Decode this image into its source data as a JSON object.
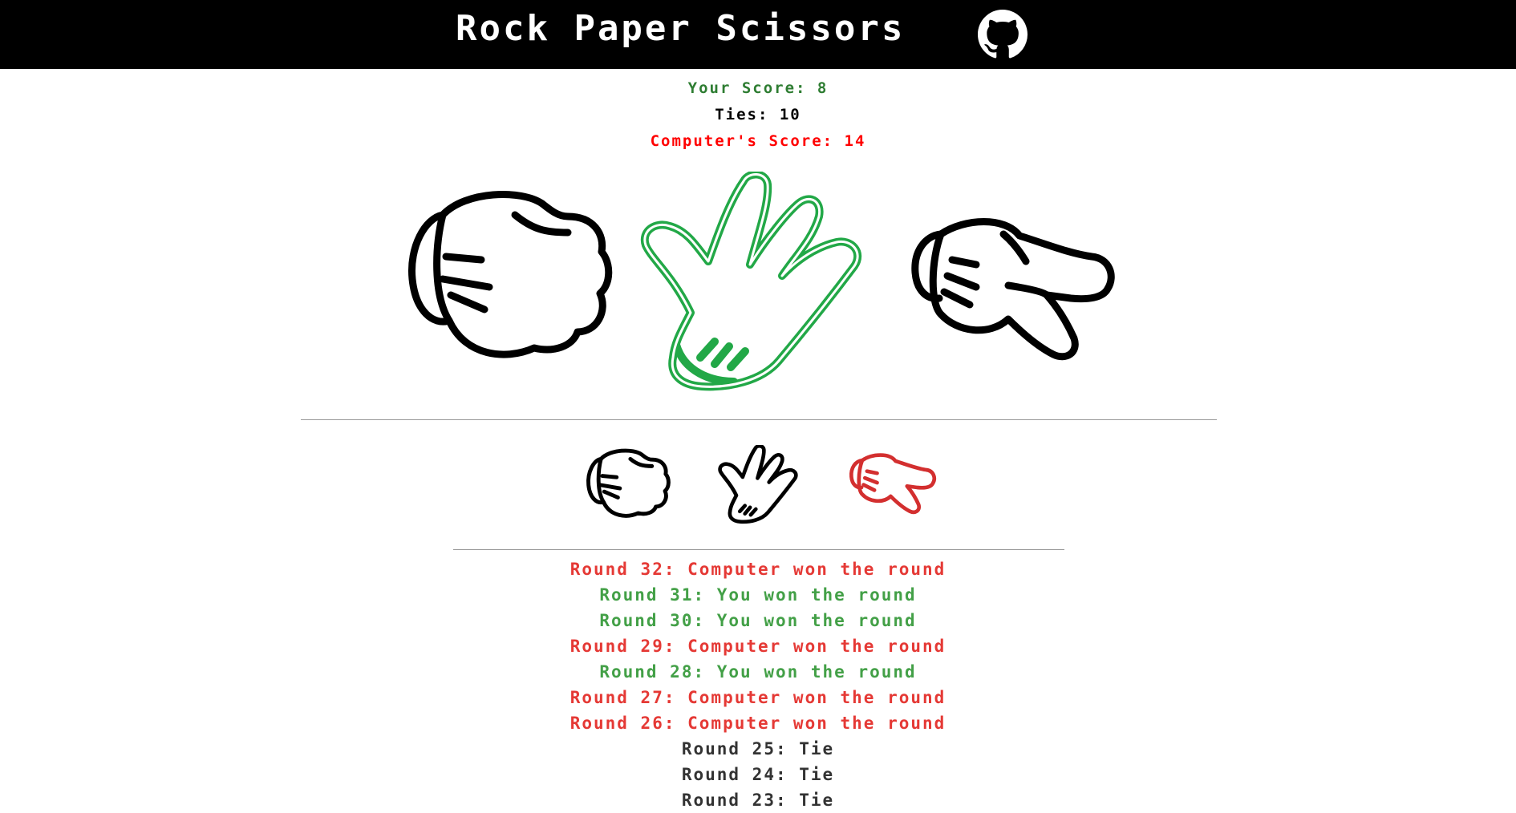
{
  "header": {
    "title": "Rock Paper Scissors",
    "github_icon": "github-icon"
  },
  "scores": {
    "your_score": "Your Score: 8",
    "ties": "Ties: 10",
    "computer_score": "Computer's Score: 14"
  },
  "colors": {
    "win": "#2e7d32",
    "win_hand": "#22a847",
    "lose": "#ff0000",
    "lose_hand": "#d32f2f",
    "tie": "#000000",
    "log_computer": "#e53935",
    "log_you": "#43a047",
    "log_tie": "#333333"
  },
  "display_hands": [
    {
      "name": "rock-hand-icon",
      "state": "default"
    },
    {
      "name": "paper-hand-icon",
      "state": "highlighted-win"
    },
    {
      "name": "scissors-hand-icon",
      "state": "default"
    }
  ],
  "choices": [
    {
      "name": "rock-choice-icon",
      "state": "default"
    },
    {
      "name": "paper-choice-icon",
      "state": "default"
    },
    {
      "name": "scissors-choice-icon",
      "state": "highlighted-computer"
    }
  ],
  "history": [
    {
      "text": "Round 32: Computer won the round",
      "result": "computer"
    },
    {
      "text": "Round 31: You won the round",
      "result": "you"
    },
    {
      "text": "Round 30: You won the round",
      "result": "you"
    },
    {
      "text": "Round 29: Computer won the round",
      "result": "computer"
    },
    {
      "text": "Round 28: You won the round",
      "result": "you"
    },
    {
      "text": "Round 27: Computer won the round",
      "result": "computer"
    },
    {
      "text": "Round 26: Computer won the round",
      "result": "computer"
    },
    {
      "text": "Round 25: Tie",
      "result": "tie"
    },
    {
      "text": "Round 24: Tie",
      "result": "tie"
    },
    {
      "text": "Round 23: Tie",
      "result": "tie"
    }
  ]
}
